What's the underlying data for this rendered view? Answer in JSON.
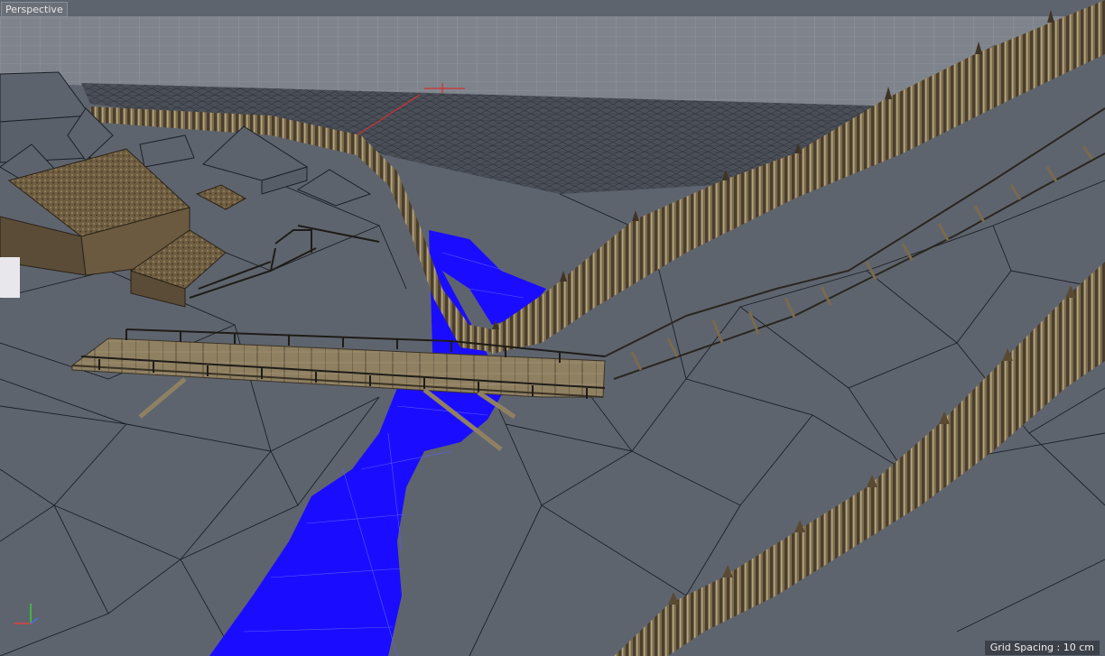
{
  "viewport": {
    "view_name": "Perspective",
    "grid_spacing_text": "Grid Spacing : 10 cm"
  },
  "colors": {
    "terrain": "#5e646e",
    "wire": "#1e2228",
    "sky_grid": "#8c9098",
    "water": "#1a0dff",
    "palisade": "#7a6a4c",
    "palisade_dark": "#3e3426",
    "wood_light": "#9a8a66",
    "roof": "#6b5a3c",
    "building_grey": "#5d636d",
    "axis_y": "#38d038",
    "axis_x": "#e04040",
    "axis_z": "#4070e0"
  },
  "icons": {
    "axis": "axis-gizmo-icon"
  }
}
